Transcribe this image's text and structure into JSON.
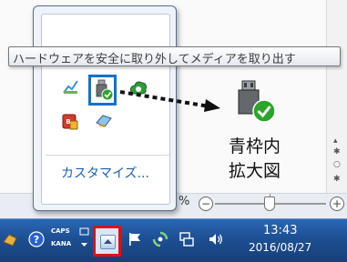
{
  "tooltip": {
    "text": "ハードウェアを安全に取り外してメディアを取り出す"
  },
  "flyout": {
    "customize_label": "カスタマイズ..."
  },
  "annotation": {
    "line1": "青枠内",
    "line2": "拡大図"
  },
  "background_app": {
    "zoom_percent": "%",
    "zoom_minus": "−",
    "zoom_plus": "+"
  },
  "taskbar": {
    "caps_label": "CAPS",
    "kana_label": "KANA",
    "clock_time": "13:43",
    "clock_date": "2016/08/27"
  },
  "icons": {
    "safely_remove": "usb-safely-remove-icon",
    "help": "help-icon",
    "ime": "ime-icon",
    "action_center": "flag-icon",
    "network": "network-icon",
    "volume": "volume-icon"
  },
  "colors": {
    "taskbar": "#1d4f93",
    "highlight_red": "#e01010",
    "highlight_blue": "#1570c8",
    "link": "#1f5dac",
    "checkmark_green": "#2aa52a"
  }
}
